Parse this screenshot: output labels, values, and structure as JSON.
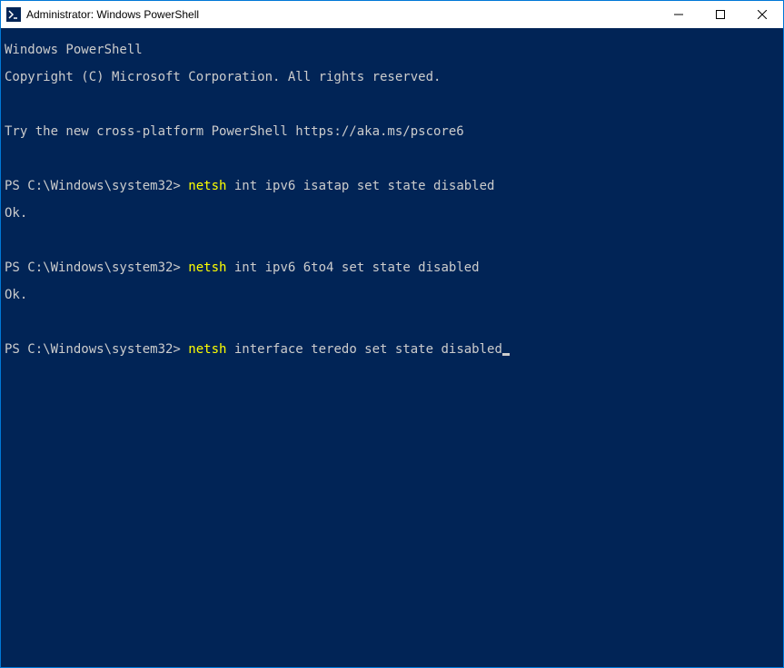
{
  "window": {
    "title": "Administrator: Windows PowerShell"
  },
  "terminal": {
    "banner": {
      "line1": "Windows PowerShell",
      "line2": "Copyright (C) Microsoft Corporation. All rights reserved.",
      "line3": "Try the new cross-platform PowerShell https://aka.ms/pscore6"
    },
    "prompt_prefix": "PS C:\\Windows\\system32> ",
    "entries": [
      {
        "cmd_highlight": "netsh",
        "cmd_rest": " int ipv6 isatap set state disabled",
        "output": "Ok."
      },
      {
        "cmd_highlight": "netsh",
        "cmd_rest": " int ipv6 6to4 set state disabled",
        "output": "Ok."
      },
      {
        "cmd_highlight": "netsh",
        "cmd_rest": " interface teredo set state disabled",
        "output": null
      }
    ]
  }
}
